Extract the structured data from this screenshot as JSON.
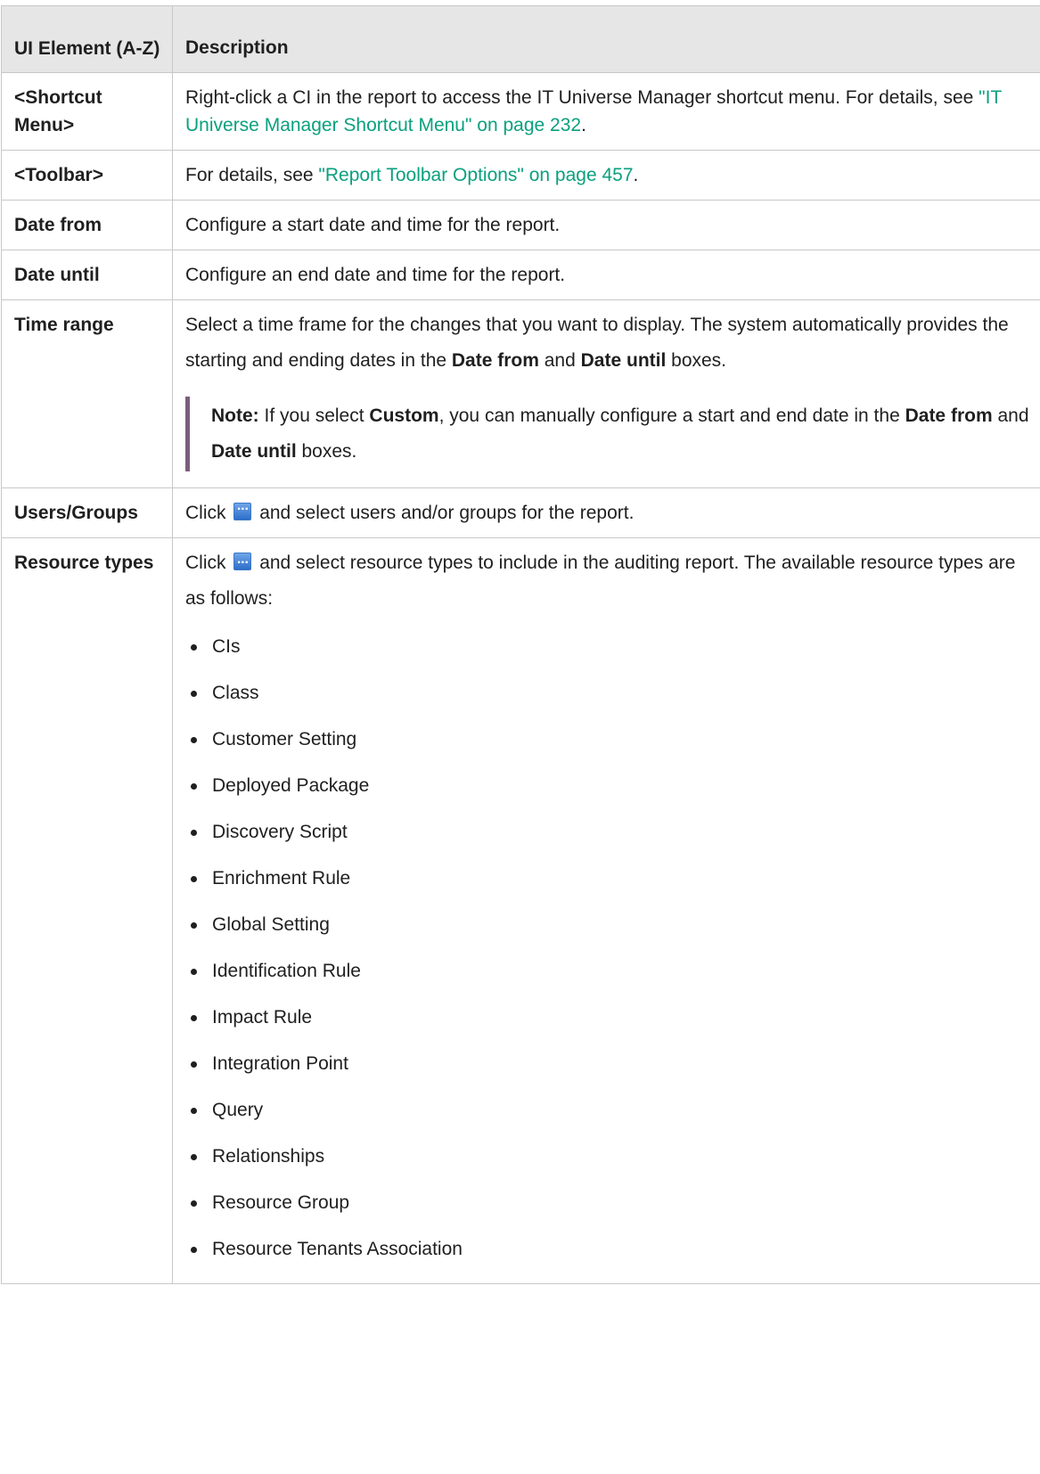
{
  "table": {
    "headers": {
      "element": "UI Element (A-Z)",
      "description": "Description"
    },
    "rows": {
      "shortcut_menu": {
        "element": "<Shortcut Menu>",
        "text_before": "Right-click a CI in the report to access the IT Universe Manager shortcut menu. For details, see ",
        "link": "\"IT Universe Manager Shortcut Menu\" on page 232",
        "text_after": "."
      },
      "toolbar": {
        "element": "<Toolbar>",
        "text_before": "For details, see ",
        "link": "\"Report Toolbar Options\" on page 457",
        "text_after": "."
      },
      "date_from": {
        "element": "Date from",
        "text": "Configure a start date and time for the report."
      },
      "date_until": {
        "element": "Date until",
        "text": "Configure an end date and time for the report."
      },
      "time_range": {
        "element": "Time range",
        "text_1": "Select a time frame for the changes that you want to display. The system automatically provides the starting and ending dates in the ",
        "bold_1": "Date from",
        "text_2": " and ",
        "bold_2": "Date until",
        "text_3": " boxes.",
        "note_label": "Note:",
        "note_1": " If you select ",
        "note_bold_1": "Custom",
        "note_2": ", you can manually configure a start and end date in the ",
        "note_bold_2": "Date from",
        "note_3": " and ",
        "note_bold_3": "Date until",
        "note_4": " boxes."
      },
      "users_groups": {
        "element": "Users/Groups",
        "text_before": "Click",
        "text_after": "and select users and/or groups for the report."
      },
      "resource_types": {
        "element": "Resource types",
        "text_before": "Click",
        "text_after": "and select resource types to include in the auditing report. The available resource types are as follows:",
        "items": [
          "CIs",
          "Class",
          "Customer Setting",
          "Deployed Package",
          "Discovery Script",
          "Enrichment Rule",
          "Global Setting",
          "Identification Rule",
          "Impact Rule",
          "Integration Point",
          "Query",
          "Relationships",
          "Resource Group",
          "Resource Tenants Association"
        ]
      }
    }
  },
  "icons": {
    "browse_button": "ellipsis-button-icon",
    "browse_glyph": "···"
  },
  "colors": {
    "link": "#0aa07e",
    "header_bg": "#e6e6e6",
    "note_bar": "#7a5f7d"
  }
}
